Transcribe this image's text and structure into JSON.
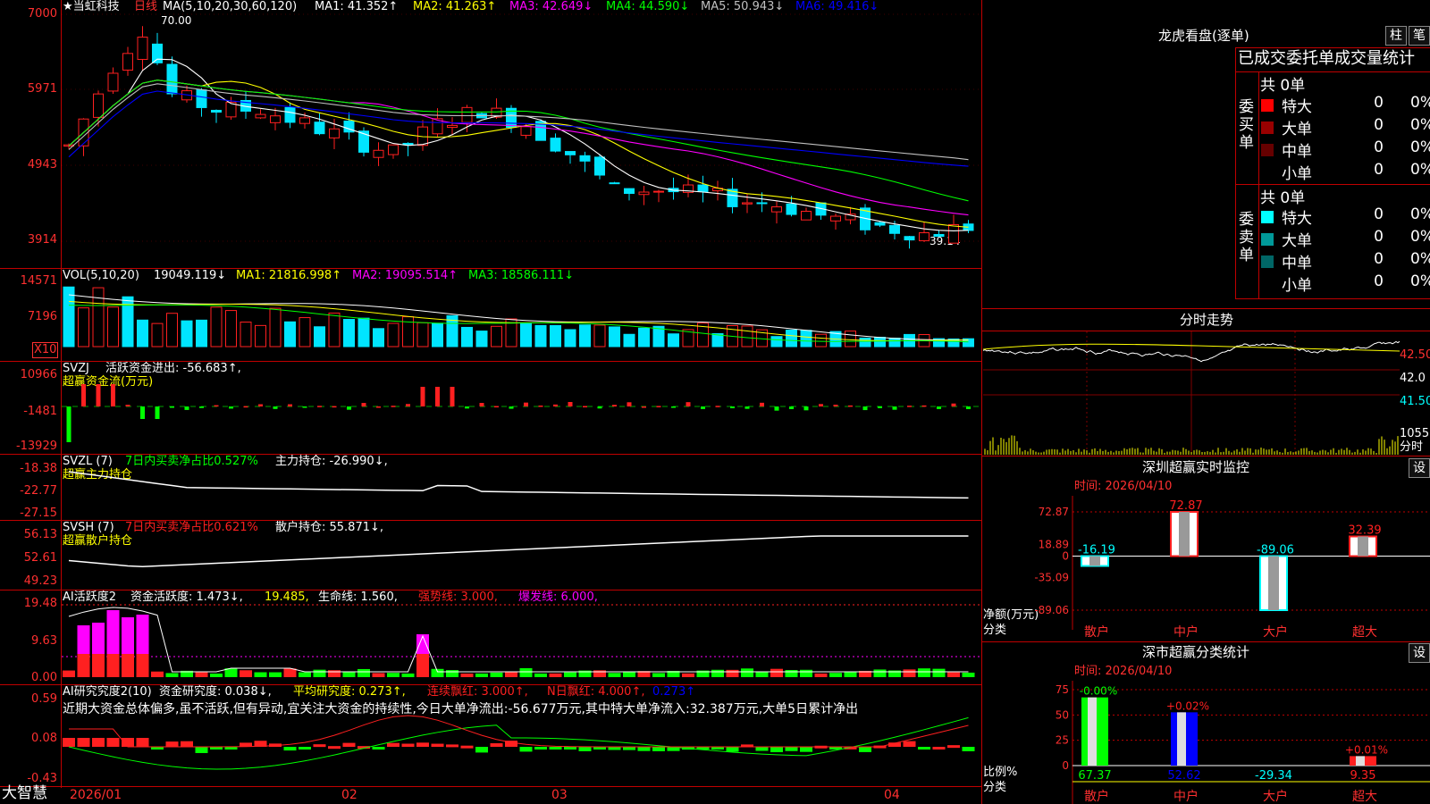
{
  "colors": {
    "up": "#ff2020",
    "down": "#00e5ff",
    "frame": "#c00000",
    "pink": "#ff00ff",
    "yellow": "#ffff00",
    "green": "#00ff00",
    "blue": "#0000ff"
  },
  "main": {
    "title": "★当虹科技",
    "period": "日线",
    "ma_title": "MA(5,10,20,30,60,120)",
    "ma1": "MA1: 41.352↑",
    "ma2": "MA2: 41.263↑",
    "ma3": "MA3: 42.649↓",
    "ma4": "MA4: 44.590↓",
    "ma5": "MA5: 50.943↓",
    "ma6": "MA6: 49.416↓",
    "high_label": "70.00",
    "low_label": "39.14",
    "yaxis": [
      "7000",
      "5971",
      "4943",
      "3914"
    ]
  },
  "vol": {
    "title": "VOL(5,10,20)",
    "v": "19049.119↓",
    "ma1": "MA1: 21816.998↑",
    "ma2": "MA2: 19095.514↑",
    "ma3": "MA3: 18586.111↓",
    "yaxis": [
      "14571",
      "7196"
    ],
    "unit": "X10"
  },
  "svzj": {
    "title": "SVZJ",
    "label": "活跃资金进出: -56.683↑,",
    "sub": "超赢资金流(万元)",
    "yaxis": [
      "10966",
      "-1481",
      "-13929"
    ]
  },
  "svzl": {
    "title": "SVZL (7)",
    "ratio": "7日内买卖净占比0.527%",
    "hold": "主力持仓: -26.990↓,",
    "sub": "超赢主力持仓",
    "yaxis": [
      "-18.38",
      "-22.77",
      "-27.15"
    ]
  },
  "svsh": {
    "title": "SVSH (7)",
    "ratio": "7日内买卖净占比0.621%",
    "hold": "散户持仓: 55.871↓,",
    "sub": "超赢散户持仓",
    "yaxis": [
      "56.13",
      "52.61",
      "49.23"
    ]
  },
  "ai_active": {
    "title": "AI活跃度2",
    "a": "资金活跃度: 1.473↓,",
    "b": "19.485,",
    "c": "生命线: 1.560,",
    "d": "强势线: 3.000,",
    "e": "爆发线: 6.000,",
    "yaxis": [
      "19.48",
      "9.63",
      "0.00"
    ]
  },
  "ai_research": {
    "title": "AI研究究度2(10)",
    "a": "资金研究度: 0.038↓,",
    "b": "平均研究度: 0.273↑,",
    "c": "连续飘红: 3.000↑,",
    "d": "N日飘红: 4.000↑,",
    "e": "0.273↑",
    "note": "近期大资金总体偏多,虽不活跃,但有异动,宜关注大资金的持续性,今日大单净流出:-56.677万元,其中特大单净流入:32.387万元,大单5日累计净出",
    "yaxis": [
      "0.59",
      "0.08",
      "-0.43"
    ]
  },
  "xaxis": {
    "labels": [
      "2026/01",
      "02",
      "03",
      "04"
    ]
  },
  "brand": "大智慧",
  "dragon": {
    "title": "龙虎看盘(逐单)",
    "btn_pillar": "柱",
    "btn_pen": "笔",
    "header": "已成交委托单成交量统计",
    "buy": {
      "side": "委买单",
      "count": "共 0单",
      "rows": [
        {
          "name": "特大",
          "val": "0",
          "pct": "0%",
          "color": "#ff0000"
        },
        {
          "name": "大单",
          "val": "0",
          "pct": "0%",
          "color": "#990000"
        },
        {
          "name": "中单",
          "val": "0",
          "pct": "0%",
          "color": "#660000"
        },
        {
          "name": "小单",
          "val": "0",
          "pct": "0%",
          "color": ""
        }
      ]
    },
    "sell": {
      "side": "委卖单",
      "count": "共 0单",
      "rows": [
        {
          "name": "特大",
          "val": "0",
          "pct": "0%",
          "color": "#00ffff"
        },
        {
          "name": "大单",
          "val": "0",
          "pct": "0%",
          "color": "#009999"
        },
        {
          "name": "中单",
          "val": "0",
          "pct": "0%",
          "color": "#006666"
        },
        {
          "name": "小单",
          "val": "0",
          "pct": "0%",
          "color": ""
        }
      ]
    }
  },
  "intraday": {
    "title": "分时走势",
    "prices": [
      "42.50",
      "42.0",
      "41.50"
    ],
    "vol_label": "1055",
    "unit": "分时"
  },
  "sz_monitor": {
    "title": "深圳超赢实时监控",
    "btn": "设",
    "time": "时间: 2026/04/10",
    "ylabel": "净额(万元)",
    "xlabel": "分类",
    "yaxis": [
      "72.87",
      "18.89",
      "0",
      "-35.09",
      "-89.06"
    ]
  },
  "sz_class": {
    "title": "深市超赢分类统计",
    "btn": "设",
    "time": "时间: 2026/04/10",
    "ylabel": "比例%",
    "xlabel": "分类",
    "yaxis": [
      "75",
      "50",
      "25",
      "0"
    ]
  },
  "chart_data": [
    {
      "type": "bar",
      "title": "深圳超赢实时监控",
      "ylabel": "净额(万元)",
      "xlabel": "分类",
      "categories": [
        "散户",
        "中户",
        "大户",
        "超大"
      ],
      "values": [
        -16.19,
        72.87,
        -89.06,
        32.39
      ],
      "ylim": [
        -89.06,
        72.87
      ]
    },
    {
      "type": "bar",
      "title": "深市超赢分类统计",
      "ylabel": "比例%",
      "xlabel": "分类",
      "categories": [
        "散户",
        "中户",
        "大户",
        "超大"
      ],
      "series": [
        {
          "values": [
            67.37,
            52.62,
            -29.34,
            9.35
          ]
        },
        {
          "values": [
            -0.0,
            0.02,
            0,
            0.01
          ]
        }
      ],
      "labels": [
        "-0.00%",
        "+0.02%",
        "",
        "+0.01%"
      ],
      "ylim": [
        0,
        75
      ]
    },
    {
      "type": "line",
      "title": "★当虹科技 日线",
      "xlabel": "",
      "ylabel": "",
      "x_labels": [
        "2026/01",
        "02",
        "03",
        "04"
      ],
      "ylim": [
        39.14,
        70.0
      ],
      "series": [
        {
          "name": "MA1",
          "values": [
            41.352
          ]
        },
        {
          "name": "MA2",
          "values": [
            41.263
          ]
        },
        {
          "name": "MA3",
          "values": [
            42.649
          ]
        },
        {
          "name": "MA4",
          "values": [
            44.59
          ]
        },
        {
          "name": "MA5",
          "values": [
            50.943
          ]
        },
        {
          "name": "MA6",
          "values": [
            49.416
          ]
        }
      ]
    }
  ]
}
